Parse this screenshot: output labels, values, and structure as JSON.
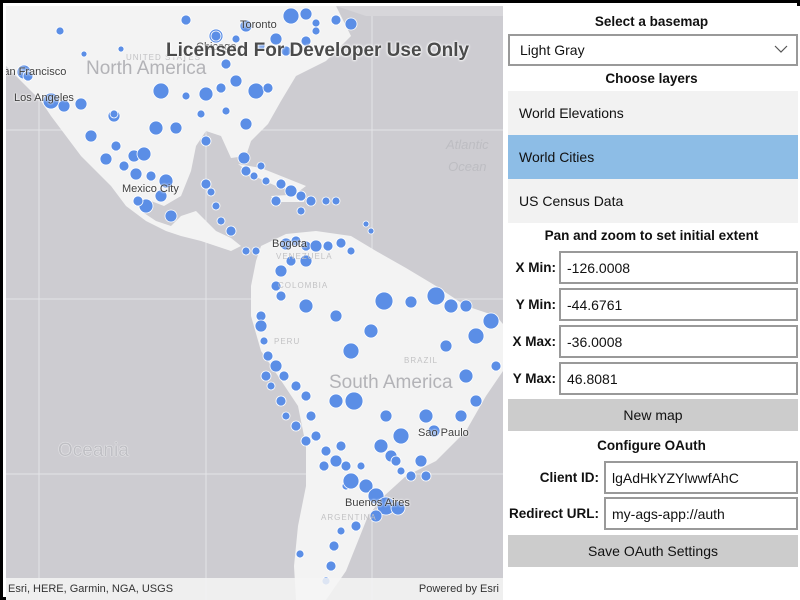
{
  "map": {
    "watermark": "Licensed For Developer Use Only",
    "attribution_left": "Esri, HERE, Garmin, NGA, USGS",
    "attribution_right": "Powered by Esri",
    "labels": {
      "continents": {
        "north_america": "North America",
        "south_america": "South America",
        "oceania": "Oceania"
      },
      "ocean": {
        "line1": "Atlantic",
        "line2": "Ocean"
      },
      "cities": {
        "toronto": "Toronto",
        "chicago": "Chicago",
        "san_francisco": "San Francisco",
        "los_angeles": "Los Angeles",
        "mexico_city": "Mexico City",
        "bogota": "Bogota",
        "sao_paulo": "Sao Paulo",
        "buenos_aires": "Buenos Aires"
      },
      "countries": {
        "united_states": "UNITED STATES",
        "venezuela": "VENEZUELA",
        "colombia": "COLOMBIA",
        "peru": "PERU",
        "brazil": "BRAZIL",
        "argentina": "ARGENTINA"
      }
    },
    "colors": {
      "ocean": "#cdccd1",
      "land": "#f3f3f3",
      "city_dot": "#5b8ee6",
      "city_dot_stroke": "#ffffff"
    }
  },
  "panel": {
    "basemap_title": "Select a basemap",
    "basemap_selected": "Light Gray",
    "layers_title": "Choose layers",
    "layers": [
      {
        "label": "World Elevations",
        "selected": false
      },
      {
        "label": "World Cities",
        "selected": true
      },
      {
        "label": "US Census Data",
        "selected": false
      }
    ],
    "extent_title": "Pan and zoom to set initial extent",
    "extent": {
      "xmin_label": "X Min:",
      "xmin_value": "-126.0008",
      "ymin_label": "Y Min:",
      "ymin_value": "-44.6761",
      "xmax_label": "X Max:",
      "xmax_value": "-36.0008",
      "ymax_label": "Y Max:",
      "ymax_value": "46.8081"
    },
    "new_map_label": "New map",
    "oauth_title": "Configure OAuth",
    "oauth": {
      "client_id_label": "Client ID:",
      "client_id_value": "lgAdHkYZYlwwfAhC",
      "redirect_label": "Redirect URL:",
      "redirect_value": "my-ags-app://auth"
    },
    "save_oauth_label": "Save OAuth Settings",
    "colors": {
      "selected_layer": "#8dbde6",
      "layer_bg": "#f2f2f2",
      "button_bg": "#cccccc"
    }
  }
}
